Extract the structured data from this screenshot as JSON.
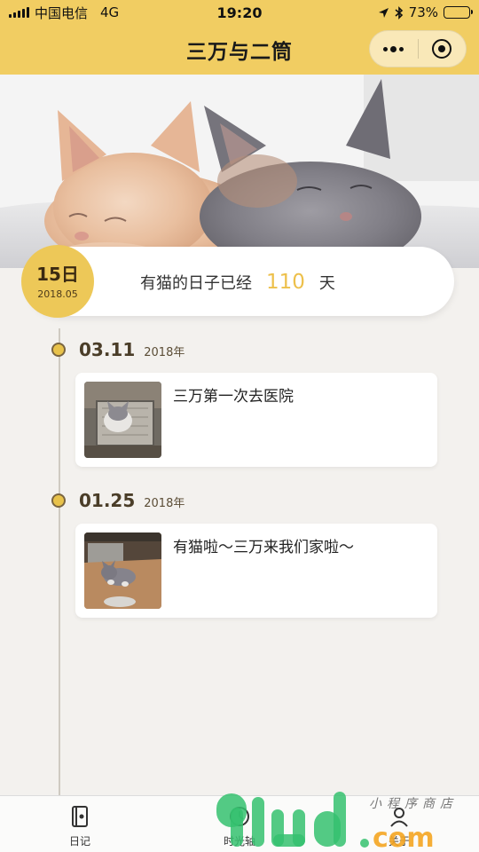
{
  "status_bar": {
    "carrier": "中国电信",
    "network": "4G",
    "time": "19:20",
    "battery": "73%",
    "battery_level": 0.73
  },
  "nav": {
    "title": "三万与二筒",
    "more_icon": "more-dots-icon",
    "close_icon": "target-icon"
  },
  "day_banner": {
    "day": "15日",
    "year_month": "2018.05",
    "prefix": "有猫的日子已经",
    "count": "110",
    "suffix": "天"
  },
  "timeline": [
    {
      "date": "03.11",
      "year": "2018年",
      "title": "三万第一次去医院"
    },
    {
      "date": "01.25",
      "year": "2018年",
      "title": "有猫啦～三万来我们家啦～"
    }
  ],
  "tabbar": [
    {
      "label": "日记",
      "icon": "diary-book-icon"
    },
    {
      "label": "时光轴",
      "icon": "clock-icon"
    },
    {
      "label": "关于",
      "icon": "person-icon"
    }
  ],
  "watermark": {
    "brand": "91ud.com",
    "tagline": "小程序商店"
  },
  "colors": {
    "accent": "#f1cd62",
    "count": "#edc04b",
    "background": "#f3f1ee"
  }
}
